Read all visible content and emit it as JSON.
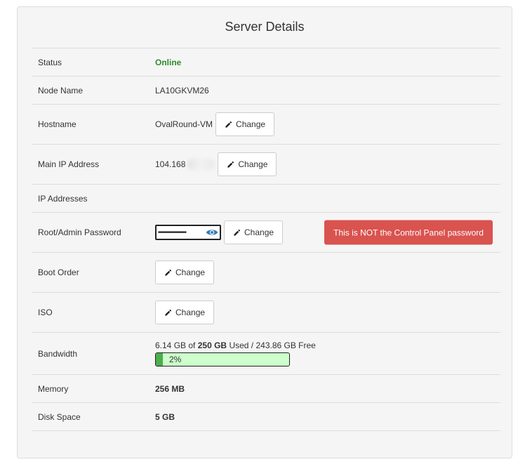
{
  "panel": {
    "title": "Server Details"
  },
  "rows": {
    "status": {
      "label": "Status",
      "value": "Online"
    },
    "node": {
      "label": "Node Name",
      "value": "LA10GKVM26"
    },
    "hostname": {
      "label": "Hostname",
      "value": "OvalRound-VM",
      "button": "Change"
    },
    "main_ip": {
      "label": "Main IP Address",
      "value": "104.168",
      "button": "Change"
    },
    "ip_addresses": {
      "label": "IP Addresses"
    },
    "password": {
      "label": "Root/Admin Password",
      "masked_value": "••••••••••••••••",
      "button": "Change",
      "warning": "This is NOT the Control Panel password"
    },
    "boot": {
      "label": "Boot Order",
      "button": "Change"
    },
    "iso": {
      "label": "ISO",
      "button": "Change"
    },
    "bandwidth": {
      "label": "Bandwidth",
      "used": "6.14 GB",
      "of": "of",
      "total": "250 GB",
      "used_word": "Used /",
      "free": "243.86 GB Free",
      "percent_label": "2%",
      "percent_value": 2
    },
    "memory": {
      "label": "Memory",
      "value": "256 MB"
    },
    "disk": {
      "label": "Disk Space",
      "value": "5 GB"
    }
  },
  "colors": {
    "online": "#2e8b2e",
    "warning_bg": "#d9534f",
    "bar_fill": "#4cae4c",
    "bar_bg": "#ccffcc",
    "eye_icon": "#337ab7"
  },
  "icons": {
    "change": "pencil-icon",
    "reveal": "eye-icon"
  }
}
